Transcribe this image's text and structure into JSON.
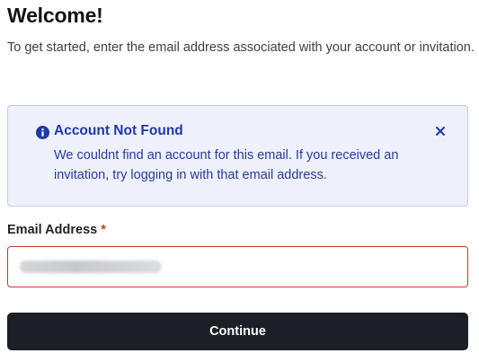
{
  "page": {
    "title": "Welcome!",
    "intro": "To get started, enter the email address associated with your account or invitation."
  },
  "alert": {
    "icon": "info-icon",
    "title": "Account Not Found",
    "message": "We couldnt find an account for this email. If you received an invitation, try logging in with that email address.",
    "close_icon": "close-icon",
    "accent_color": "#1f39a8",
    "background_color": "#eef0fb"
  },
  "form": {
    "email_label": "Email Address",
    "required_marker": "*",
    "email_value": "",
    "email_value_obscured": true,
    "error_color": "#c83a37"
  },
  "actions": {
    "continue_label": "Continue",
    "button_color": "#1d1f26"
  }
}
